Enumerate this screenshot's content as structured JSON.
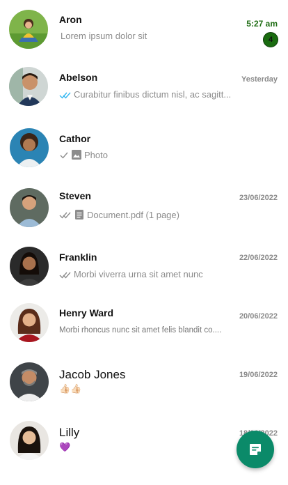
{
  "chats": [
    {
      "name": "Aron",
      "time": "5:27 am",
      "preview": "Lorem ipsum dolor sit",
      "unread": "4",
      "status": "none"
    },
    {
      "name": "Abelson",
      "time": "Yesterday",
      "preview": "Curabitur finibus dictum nisl, ac sagitt...",
      "status": "double-check-read-icon"
    },
    {
      "name": "Cathor",
      "time": "",
      "preview": "Photo",
      "status": "single-check-icon",
      "attachment": "image-icon"
    },
    {
      "name": "Steven",
      "time": "23/06/2022",
      "preview": "Document.pdf (1 page)",
      "status": "double-check-icon",
      "attachment": "document-icon"
    },
    {
      "name": "Franklin",
      "time": "22/06/2022",
      "preview": "Morbi viverra urna sit amet nunc",
      "status": "double-check-icon"
    },
    {
      "name": "Henry Ward",
      "time": "20/06/2022",
      "preview": "Morbi rhoncus nunc sit amet felis blandit co...."
    },
    {
      "name": "Jacob Jones",
      "time": "19/06/2022",
      "preview": "👍🏻👍🏻"
    },
    {
      "name": "Lilly",
      "time": "18/06/2022",
      "preview": "💜"
    }
  ],
  "fab": {
    "icon": "new-message-icon"
  },
  "colors": {
    "unread_time": "#1f6d14",
    "badge": "#1a6b10",
    "read_check": "#34b7f1",
    "fab": "#0b8a69"
  }
}
